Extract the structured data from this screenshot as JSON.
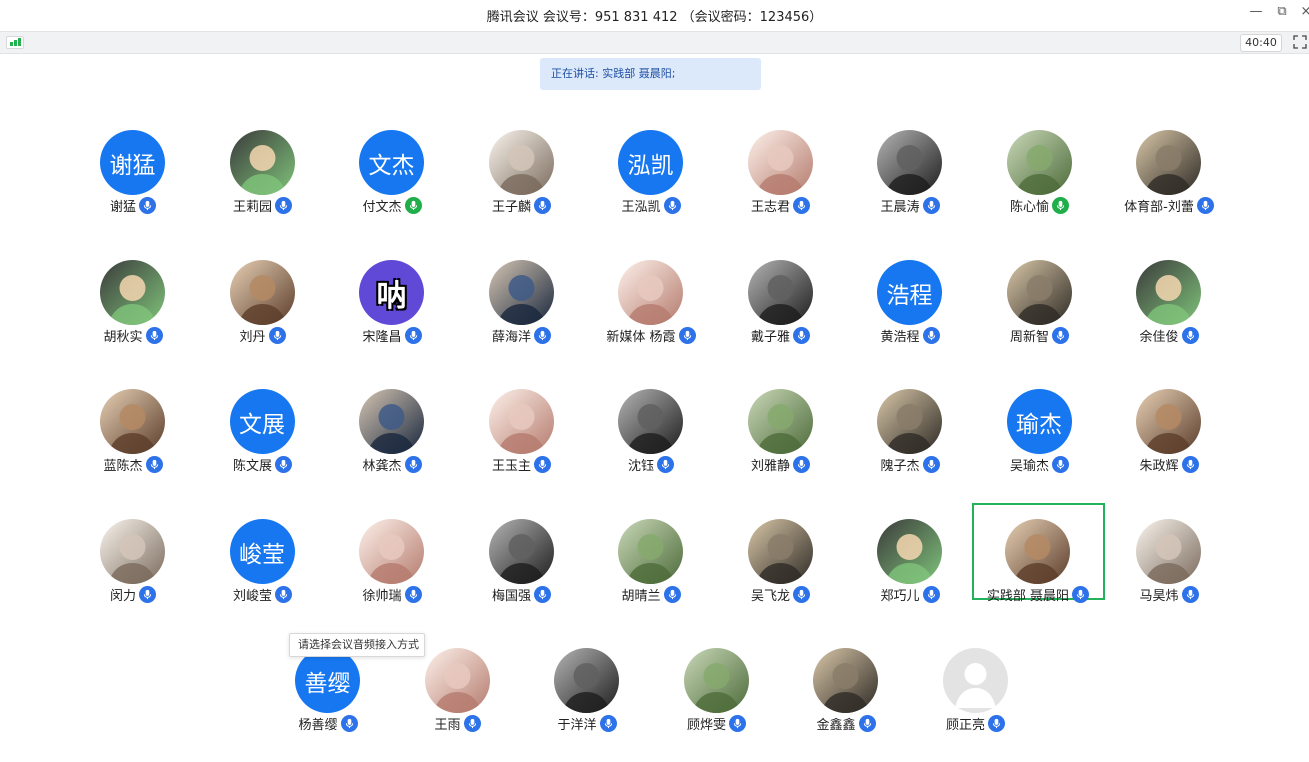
{
  "window": {
    "title": "腾讯会议 会议号：951 831 412 （会议密码：123456）",
    "minimize_icon": "—",
    "restore_icon": "⧉",
    "close_icon": "×"
  },
  "toolbar": {
    "timer": "40:40"
  },
  "banner": {
    "speaking": "正在讲话: 实践部 聂晨阳;"
  },
  "tooltip": {
    "text": "请选择会议音频接入方式"
  },
  "colors": {
    "accent": "#1677f0",
    "mic_blue": "#2d72e8",
    "mic_green": "#1fae49",
    "active_border": "#22b25a",
    "banner_bg": "#dbe9fb"
  },
  "participants": [
    {
      "name": "谢猛",
      "avatar_text": "谢猛",
      "avatar_kind": "text",
      "mic": "blue"
    },
    {
      "name": "王莉园",
      "avatar_kind": "photo",
      "icon": "cartoon-girl-avatar",
      "mic": "blue"
    },
    {
      "name": "付文杰",
      "avatar_text": "文杰",
      "avatar_kind": "text",
      "mic": "green"
    },
    {
      "name": "王子麟",
      "avatar_kind": "photo",
      "icon": "street-photo-avatar",
      "mic": "blue"
    },
    {
      "name": "王泓凯",
      "avatar_text": "泓凯",
      "avatar_kind": "text",
      "mic": "blue"
    },
    {
      "name": "王志君",
      "avatar_kind": "photo",
      "icon": "green-dino-avatar",
      "mic": "blue"
    },
    {
      "name": "王晨涛",
      "avatar_kind": "photo",
      "icon": "child-photo-avatar",
      "mic": "blue"
    },
    {
      "name": "陈心愉",
      "avatar_kind": "photo",
      "icon": "pig-toy-avatar",
      "mic": "green"
    },
    {
      "name": "体育部-刘蕾",
      "avatar_kind": "photo",
      "icon": "girl-photo-avatar",
      "mic": "blue"
    },
    {
      "name": "胡秋实",
      "avatar_kind": "photo",
      "icon": "anime-boy-avatar",
      "mic": "blue"
    },
    {
      "name": "刘丹",
      "avatar_kind": "photo",
      "icon": "cartoon-face-avatar",
      "mic": "blue"
    },
    {
      "name": "宋隆昌",
      "avatar_text": "呐",
      "avatar_kind": "text-purple",
      "mic": "blue"
    },
    {
      "name": "薛海洋",
      "avatar_kind": "photo",
      "icon": "anime-boy-avatar",
      "mic": "blue"
    },
    {
      "name": "新媒体 杨霞",
      "avatar_kind": "photo",
      "icon": "cat-photo-avatar",
      "mic": "blue"
    },
    {
      "name": "戴子雅",
      "avatar_kind": "photo",
      "icon": "room-photo-avatar",
      "mic": "blue"
    },
    {
      "name": "黄浩程",
      "avatar_text": "浩程",
      "avatar_kind": "text",
      "mic": "blue"
    },
    {
      "name": "周新智",
      "avatar_kind": "photo",
      "icon": "pink-toy-avatar",
      "mic": "blue"
    },
    {
      "name": "余佳俊",
      "avatar_kind": "photo",
      "icon": "yellow-rabbit-avatar",
      "mic": "blue"
    },
    {
      "name": "蓝陈杰",
      "avatar_kind": "photo",
      "icon": "bw-portrait-avatar",
      "mic": "blue"
    },
    {
      "name": "陈文展",
      "avatar_text": "文展",
      "avatar_kind": "text",
      "mic": "blue"
    },
    {
      "name": "林龚杰",
      "avatar_kind": "photo",
      "icon": "landscape-avatar",
      "mic": "blue"
    },
    {
      "name": "王玉主",
      "avatar_kind": "photo",
      "icon": "camera-lens-avatar",
      "mic": "blue"
    },
    {
      "name": "沈钰",
      "avatar_kind": "photo",
      "icon": "girl-photo-avatar",
      "mic": "blue"
    },
    {
      "name": "刘雅静",
      "avatar_kind": "photo",
      "icon": "girl-photo-avatar",
      "mic": "blue"
    },
    {
      "name": "隗子杰",
      "avatar_kind": "photo",
      "icon": "cat-photo-avatar",
      "mic": "blue"
    },
    {
      "name": "吴瑜杰",
      "avatar_text": "瑜杰",
      "avatar_kind": "text",
      "mic": "blue"
    },
    {
      "name": "朱政辉",
      "avatar_kind": "photo",
      "icon": "outdoor-photo-avatar",
      "mic": "blue"
    },
    {
      "name": "闵力",
      "avatar_kind": "photo",
      "icon": "dark-figure-avatar",
      "mic": "blue"
    },
    {
      "name": "刘峻莹",
      "avatar_text": "峻莹",
      "avatar_kind": "text",
      "mic": "blue"
    },
    {
      "name": "徐帅瑞",
      "avatar_kind": "photo",
      "icon": "hand-jar-avatar",
      "mic": "blue"
    },
    {
      "name": "梅国强",
      "avatar_kind": "photo",
      "icon": "doll-photo-avatar",
      "mic": "blue"
    },
    {
      "name": "胡晴兰",
      "avatar_kind": "photo",
      "icon": "anime-swordsman-avatar",
      "mic": "blue"
    },
    {
      "name": "吴飞龙",
      "avatar_kind": "photo",
      "icon": "soldier-avatar",
      "mic": "blue"
    },
    {
      "name": "郑巧儿",
      "avatar_kind": "photo",
      "icon": "kitten-avatar",
      "mic": "blue"
    },
    {
      "name": "实践部 聂晨阳",
      "avatar_kind": "photo",
      "icon": "moomin-avatar",
      "mic": "blue",
      "active": true
    },
    {
      "name": "马昊炜",
      "avatar_kind": "photo",
      "icon": "cat-cheese-avatar",
      "mic": "blue"
    },
    {
      "name": "杨善缨",
      "avatar_text": "善缨",
      "avatar_kind": "text",
      "mic": "blue"
    },
    {
      "name": "王雨",
      "avatar_kind": "photo",
      "icon": "anime-girl-avatar",
      "mic": "blue"
    },
    {
      "name": "于洋洋",
      "avatar_kind": "photo",
      "icon": "dark-portrait-avatar",
      "mic": "blue"
    },
    {
      "name": "顾烨雯",
      "avatar_kind": "photo",
      "icon": "girl-photo-avatar",
      "mic": "blue"
    },
    {
      "name": "金鑫鑫",
      "avatar_kind": "photo",
      "icon": "boy-portrait-avatar",
      "mic": "blue"
    },
    {
      "name": "顾正亮",
      "avatar_kind": "default",
      "icon": "default-user-avatar",
      "mic": "blue"
    }
  ]
}
